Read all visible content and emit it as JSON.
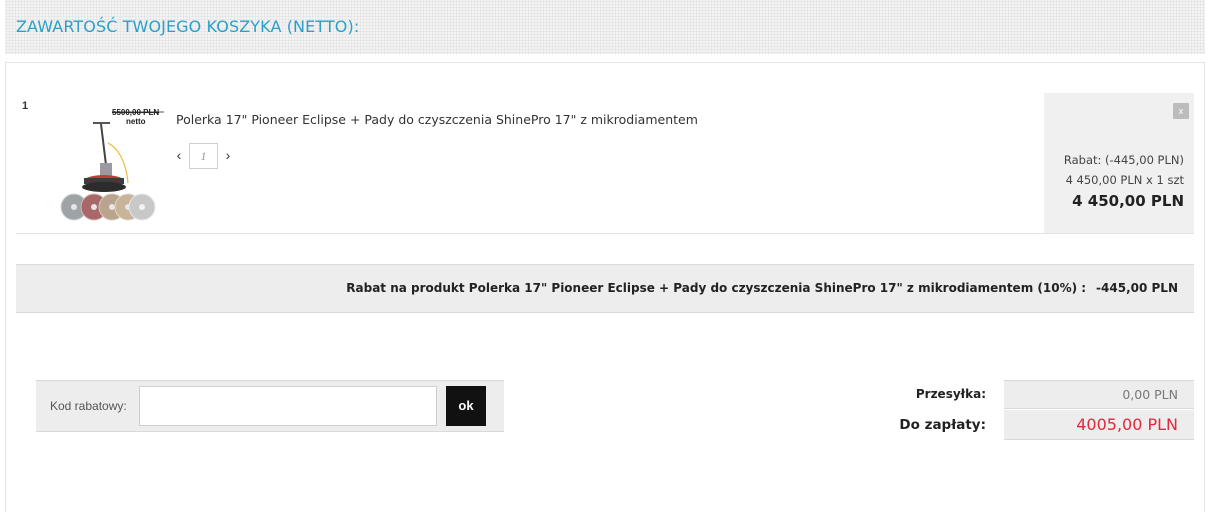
{
  "header": {
    "title": "ZAWARTOŚĆ TWOJEGO KOSZYKA (NETTO):"
  },
  "cart": {
    "items": [
      {
        "index": "1",
        "name": "Polerka 17\" Pioneer Eclipse + Pady do czyszczenia ShinePro 17\" z mikrodiamentem",
        "thumbnail_price_old": "5500,00 PLN",
        "thumbnail_price_label": "netto",
        "quantity": "1",
        "rabat": "Rabat: (-445,00 PLN)",
        "unit_price": "4 450,00 PLN x 1 szt",
        "total": "4 450,00 PLN",
        "remove_label": "x"
      }
    ],
    "discount_row": {
      "text": "Rabat na produkt Polerka 17\" Pioneer Eclipse + Pady do czyszczenia ShinePro 17\" z mikrodiamentem (10%) :",
      "amount": "-445,00 PLN"
    }
  },
  "coupon": {
    "label": "Kod rabatowy:",
    "value": "",
    "button": "ok"
  },
  "summary": {
    "shipping_label": "Przesyłka:",
    "shipping_value": "0,00 PLN",
    "pay_label": "Do zapłaty:",
    "pay_value": "4005,00 PLN"
  },
  "colors": {
    "accent": "#2aa0c8",
    "total_red": "#e0293a"
  },
  "icons": {
    "qty_prev": "chevron-left-icon",
    "qty_next": "chevron-right-icon",
    "remove": "close-icon"
  }
}
